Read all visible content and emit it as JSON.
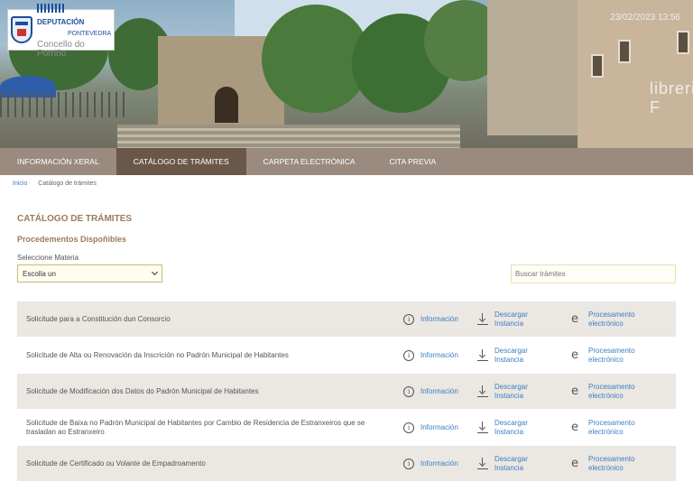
{
  "header": {
    "timestamp": "23/02/2023 13:56",
    "storefront_sign": "libreria F",
    "logo": {
      "deputacion": "DEPUTACIÓN",
      "pontevedra": "PONTEVEDRA",
      "concello": "Concello do Porriño"
    }
  },
  "nav": {
    "items": [
      {
        "label": "INFORMACIÓN XERAL"
      },
      {
        "label": "CATÁLOGO DE TRÁMITES"
      },
      {
        "label": "CARPETA ELECTRÓNICA"
      },
      {
        "label": "CITA PREVIA"
      }
    ],
    "active_index": 1
  },
  "breadcrumb": {
    "home": "Inicio",
    "current": "Catálogo de trámites"
  },
  "page": {
    "title": "CATÁLOGO DE TRÁMITES",
    "subtitle": "Procedementos Dispoñibles",
    "select_label": "Seleccione Materia",
    "select_value": "Escolla un",
    "search_placeholder": "Buscar trámites"
  },
  "actions": {
    "info": "Información",
    "download_1": "Descargar",
    "download_2": "Instancia",
    "proc_1": "Procesamento",
    "proc_2": "electrónico"
  },
  "procedures": [
    {
      "title": "Solicitude para a Constitución dun Consorcio"
    },
    {
      "title": "Solicitude de Alta ou Renovación da Inscrición no Padrón Municipal de Habitantes"
    },
    {
      "title": "Solicitude de Modificación dos Datos do Padrón Municipal de Habitantes"
    },
    {
      "title": "Solicitude de Baixa no Padrón Municipal de Habitantes por Cambio de Residencia de Estranxeiros que se trasladan ao Estranxeiro"
    },
    {
      "title": "Solicitude de Certificado ou Volante de Empadroamento"
    }
  ],
  "colors": {
    "nav_bg": "#9a8b7e",
    "nav_active": "#6b5748",
    "heading": "#9a7b5e",
    "link": "#3b7fc4",
    "row_alt": "#ebe7e2"
  }
}
